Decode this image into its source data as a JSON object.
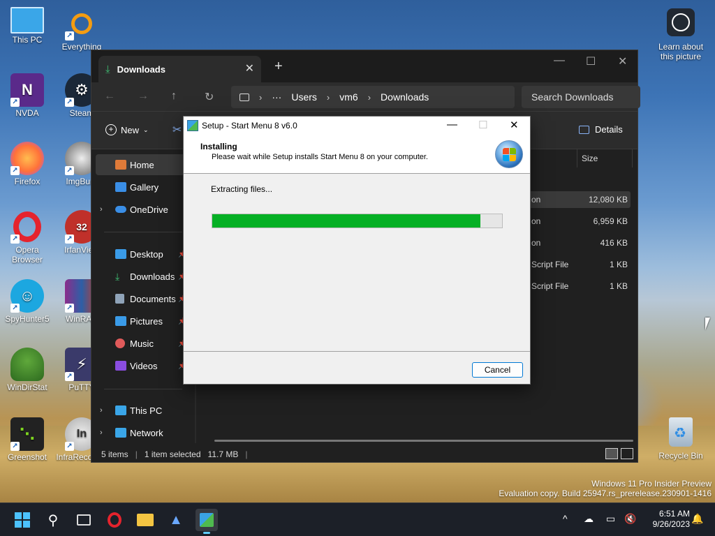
{
  "desktop": {
    "icons": [
      {
        "label": "This PC"
      },
      {
        "label": "Everything"
      },
      {
        "label": "NVDA"
      },
      {
        "label": "Steam"
      },
      {
        "label": "Firefox"
      },
      {
        "label": "ImgBurn"
      },
      {
        "label": "Opera Browser"
      },
      {
        "label": "IrfanView"
      },
      {
        "label": "SpyHunter5"
      },
      {
        "label": "WinRAR"
      },
      {
        "label": "WinDirStat"
      },
      {
        "label": "PuTTY"
      },
      {
        "label": "Greenshot"
      },
      {
        "label": "InfraRecorder"
      }
    ],
    "learn_label": "Learn about this picture",
    "recycle_label": "Recycle Bin",
    "watermark_line1": "Windows 11 Pro Insider Preview",
    "watermark_line2": "Evaluation copy. Build 25947.rs_prerelease.230901-1416"
  },
  "explorer": {
    "tab_title": "Downloads",
    "address": {
      "root_icon": "monitor-icon",
      "ellipsis": "···",
      "segments": [
        "Users",
        "vm6",
        "Downloads"
      ]
    },
    "search_placeholder": "Search Downloads",
    "new_label": "New",
    "details_label": "Details",
    "sidebar": [
      {
        "label": "Home",
        "active": true
      },
      {
        "label": "Gallery"
      },
      {
        "label": "OneDrive",
        "expandable": true
      },
      {
        "label": "Desktop",
        "pinned": true
      },
      {
        "label": "Downloads",
        "pinned": true
      },
      {
        "label": "Documents",
        "pinned": true
      },
      {
        "label": "Pictures",
        "pinned": true
      },
      {
        "label": "Music",
        "pinned": true
      },
      {
        "label": "Videos",
        "pinned": true
      },
      {
        "label": "This PC",
        "expandable": true
      },
      {
        "label": "Network",
        "expandable": true
      }
    ],
    "column_size": "Size",
    "files": [
      {
        "type": "on",
        "size": "12,080 KB",
        "selected": true
      },
      {
        "type": "on",
        "size": "6,959 KB"
      },
      {
        "type": "on",
        "size": "416 KB"
      },
      {
        "type": "Script File",
        "size": "1 KB"
      },
      {
        "type": "Script File",
        "size": "1 KB"
      }
    ],
    "status": {
      "count": "5 items",
      "selected": "1 item selected",
      "size": "11.7 MB"
    }
  },
  "setup": {
    "title": "Setup - Start Menu 8 v6.0",
    "heading": "Installing",
    "subheading": "Please wait while Setup installs Start Menu 8 on your computer.",
    "status": "Extracting files...",
    "progress_fraction": 0.925,
    "cancel_label": "Cancel"
  },
  "taskbar": {
    "time": "6:51 AM",
    "date": "9/26/2023"
  }
}
